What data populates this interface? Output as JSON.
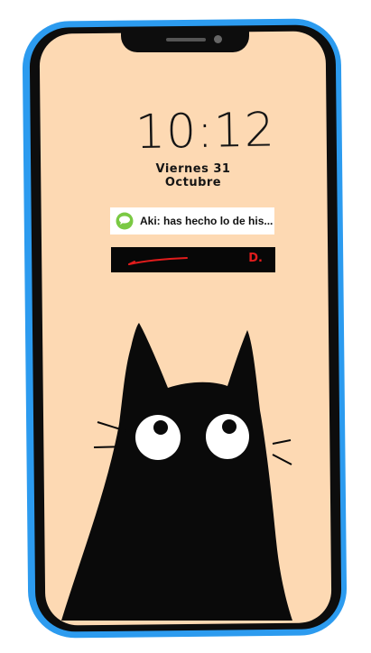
{
  "lockscreen": {
    "time": "10:12",
    "date": "Viernes 31 Octubre"
  },
  "notification": {
    "text": "Aki: has hecho lo de his...",
    "app_icon": "message-bubble-icon",
    "icon_color": "#7ac943"
  },
  "hidden_bar": {
    "suffix": "D."
  },
  "colors": {
    "case": "#2c9bef",
    "frame": "#0d0d0d",
    "screen_bg": "#fdd9b3",
    "accent_red": "#e11c1c"
  }
}
